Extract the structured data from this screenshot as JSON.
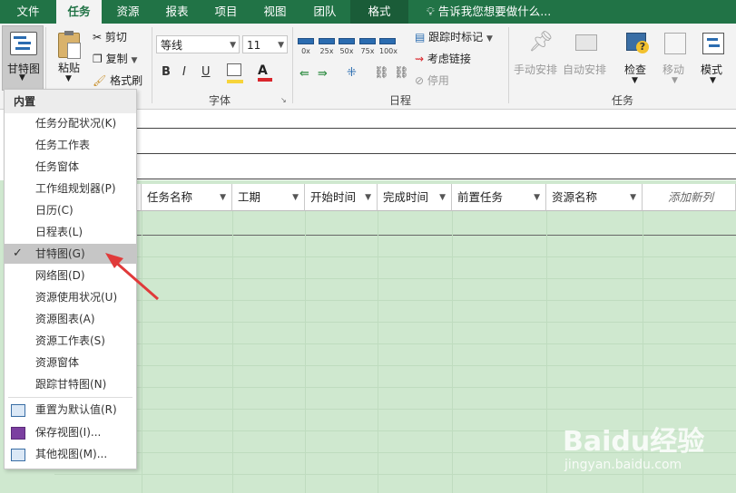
{
  "menubar": {
    "tabs": [
      "文件",
      "任务",
      "资源",
      "报表",
      "项目",
      "视图",
      "团队",
      "格式"
    ],
    "active_tab": "任务",
    "tell_me": "告诉我您想要做什么..."
  },
  "ribbon": {
    "view_button": "甘特图",
    "paste": "粘贴",
    "cut": "剪切",
    "copy": "复制",
    "format_painter": "格式刷",
    "font_name": "等线",
    "font_size": "11",
    "bold": "B",
    "italic": "I",
    "underline": "U",
    "schedule_pcts": [
      "0x",
      "25x",
      "50x",
      "75x",
      "100x"
    ],
    "track": "跟踪时标记",
    "respect_links": "考虑链接",
    "inactivate": "停用",
    "manual": "手动安排",
    "auto": "自动安排",
    "inspect": "检查",
    "move": "移动",
    "mode": "模式",
    "groups": {
      "font": "字体",
      "schedule": "日程",
      "tasks": "任务"
    }
  },
  "sheet": {
    "columns": [
      "任务名称",
      "工期",
      "开始时间",
      "完成时间",
      "前置任务",
      "资源名称",
      "添加新列"
    ]
  },
  "view_menu": {
    "header": "内置",
    "items": [
      "任务分配状况(K)",
      "任务工作表",
      "任务窗体",
      "工作组规划器(P)",
      "日历(C)",
      "日程表(L)",
      "甘特图(G)",
      "网络图(D)",
      "资源使用状况(U)",
      "资源图表(A)",
      "资源工作表(S)",
      "资源窗体",
      "跟踪甘特图(N)"
    ],
    "selected": "甘特图(G)",
    "actions": [
      "重置为默认值(R)",
      "保存视图(I)...",
      "其他视图(M)..."
    ]
  },
  "watermark": {
    "brand": "Baidu经验",
    "url": "jingyan.baidu.com"
  },
  "colors": {
    "brand_green": "#217346",
    "sheet_green": "#cfe8cf",
    "arrow_red": "#e03a3a"
  }
}
